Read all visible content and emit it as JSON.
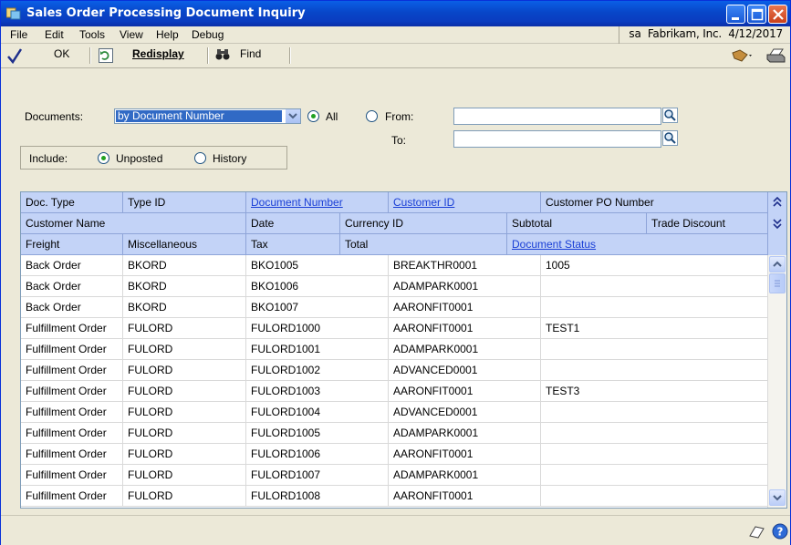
{
  "window": {
    "title": "Sales Order Processing Document Inquiry"
  },
  "menubar": {
    "items": [
      "File",
      "Edit",
      "Tools",
      "View",
      "Help",
      "Debug"
    ],
    "user_info": "sa  Fabrikam, Inc.  4/12/2017"
  },
  "toolbar": {
    "ok_label": "OK",
    "redisplay_label": "Redisplay",
    "find_label": "Find"
  },
  "filters": {
    "documents_label": "Documents:",
    "documents_selected": "by Document Number",
    "all_label": "All",
    "from_label": "From:",
    "to_label": "To:",
    "from_value": "",
    "to_value": "",
    "range_selected": "All",
    "include_label": "Include:",
    "unposted_label": "Unposted",
    "history_label": "History",
    "include_selected": "Unposted"
  },
  "grid": {
    "header_row1": [
      "Doc. Type",
      "Type ID",
      "Document Number",
      "Customer ID",
      "Customer PO Number"
    ],
    "header_row2": [
      "Customer Name",
      "Date",
      "Currency ID",
      "Subtotal",
      "Trade Discount"
    ],
    "header_row3": [
      "Freight",
      "Miscellaneous",
      "Tax",
      "Total",
      "Document Status"
    ],
    "rows": [
      {
        "doc_type": "Back Order",
        "type_id": "BKORD",
        "doc_number": "BKO1005",
        "customer_id": "BREAKTHR0001",
        "po_number": "1005"
      },
      {
        "doc_type": "Back Order",
        "type_id": "BKORD",
        "doc_number": "BKO1006",
        "customer_id": "ADAMPARK0001",
        "po_number": ""
      },
      {
        "doc_type": "Back Order",
        "type_id": "BKORD",
        "doc_number": "BKO1007",
        "customer_id": "AARONFIT0001",
        "po_number": ""
      },
      {
        "doc_type": "Fulfillment Order",
        "type_id": "FULORD",
        "doc_number": "FULORD1000",
        "customer_id": "AARONFIT0001",
        "po_number": "TEST1"
      },
      {
        "doc_type": "Fulfillment Order",
        "type_id": "FULORD",
        "doc_number": "FULORD1001",
        "customer_id": "ADAMPARK0001",
        "po_number": ""
      },
      {
        "doc_type": "Fulfillment Order",
        "type_id": "FULORD",
        "doc_number": "FULORD1002",
        "customer_id": "ADVANCED0001",
        "po_number": ""
      },
      {
        "doc_type": "Fulfillment Order",
        "type_id": "FULORD",
        "doc_number": "FULORD1003",
        "customer_id": "AARONFIT0001",
        "po_number": "TEST3"
      },
      {
        "doc_type": "Fulfillment Order",
        "type_id": "FULORD",
        "doc_number": "FULORD1004",
        "customer_id": "ADVANCED0001",
        "po_number": ""
      },
      {
        "doc_type": "Fulfillment Order",
        "type_id": "FULORD",
        "doc_number": "FULORD1005",
        "customer_id": "ADAMPARK0001",
        "po_number": ""
      },
      {
        "doc_type": "Fulfillment Order",
        "type_id": "FULORD",
        "doc_number": "FULORD1006",
        "customer_id": "AARONFIT0001",
        "po_number": ""
      },
      {
        "doc_type": "Fulfillment Order",
        "type_id": "FULORD",
        "doc_number": "FULORD1007",
        "customer_id": "ADAMPARK0001",
        "po_number": ""
      },
      {
        "doc_type": "Fulfillment Order",
        "type_id": "FULORD",
        "doc_number": "FULORD1008",
        "customer_id": "AARONFIT0001",
        "po_number": ""
      }
    ]
  },
  "colors": {
    "title_bar": "#0A47CF",
    "header_bg": "#C3D3F7",
    "link": "#1A3FD6",
    "selection": "#316AC5"
  },
  "icons": [
    "app-icon",
    "minimize-icon",
    "maximize-icon",
    "close-icon",
    "checkmark-icon",
    "redisplay-icon",
    "binoculars-icon",
    "lookup-icon",
    "goto-icon",
    "print-icon",
    "expand-icon",
    "collapse-icon",
    "note-icon",
    "help-icon"
  ]
}
